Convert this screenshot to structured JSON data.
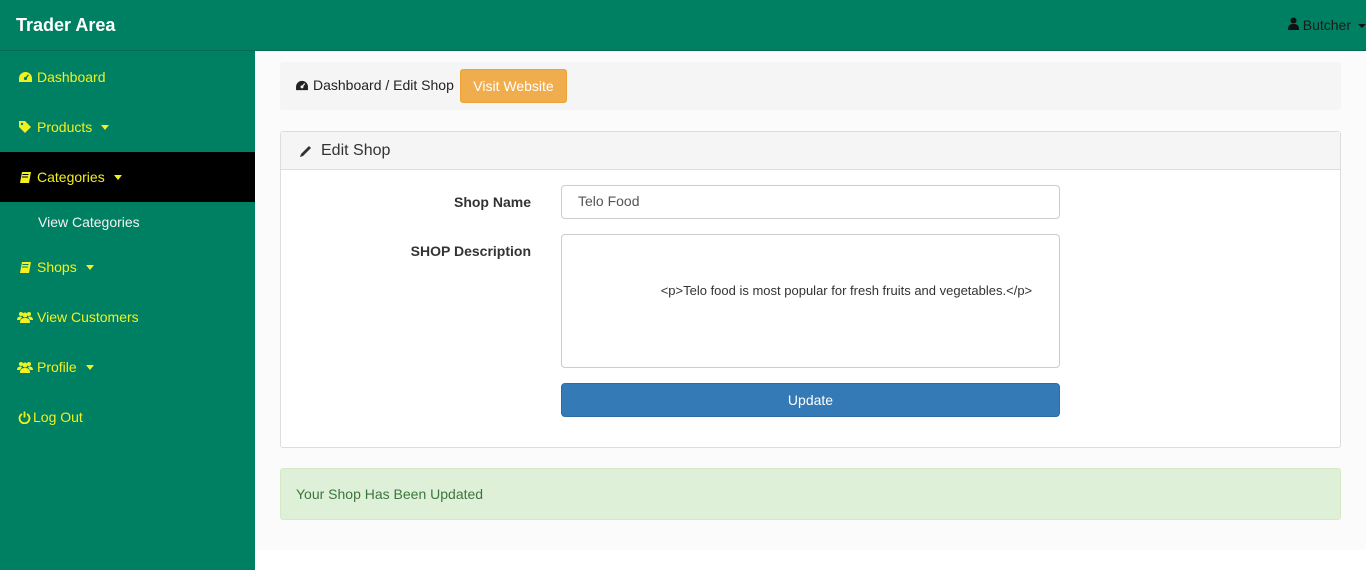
{
  "header": {
    "brand": "Trader Area",
    "user_name": "Butcher"
  },
  "sidebar": {
    "items": [
      {
        "label": "Dashboard",
        "icon": "dashboard-icon"
      },
      {
        "label": "Products",
        "icon": "tag-icon"
      },
      {
        "label": "Categories",
        "icon": "book-icon",
        "active": true
      },
      {
        "label": "View Categories"
      },
      {
        "label": "Shops",
        "icon": "book-icon"
      },
      {
        "label": "View Customers",
        "icon": "users-icon"
      },
      {
        "label": "Profile",
        "icon": "users-icon"
      },
      {
        "label": "Log Out",
        "icon": "power-icon"
      }
    ]
  },
  "breadcrumb": {
    "text": "Dashboard / Edit Shop",
    "visit_button": "Visit Website"
  },
  "panel": {
    "title": "Edit Shop",
    "shop_name_label": "Shop Name",
    "shop_name_value": "Telo Food",
    "description_label": "SHOP Description",
    "description_value": "                    <p>Telo food is most popular for fresh fruits and vegetables.</p>",
    "update_button": "Update"
  },
  "alert": {
    "message": "Your Shop Has Been Updated"
  },
  "colors": {
    "sidebar_bg": "#008062",
    "nav_text": "#f2f01f",
    "active_bg": "#000000",
    "warning": "#f0ad4e",
    "primary": "#337ab7",
    "success_bg": "#dff0d8"
  }
}
